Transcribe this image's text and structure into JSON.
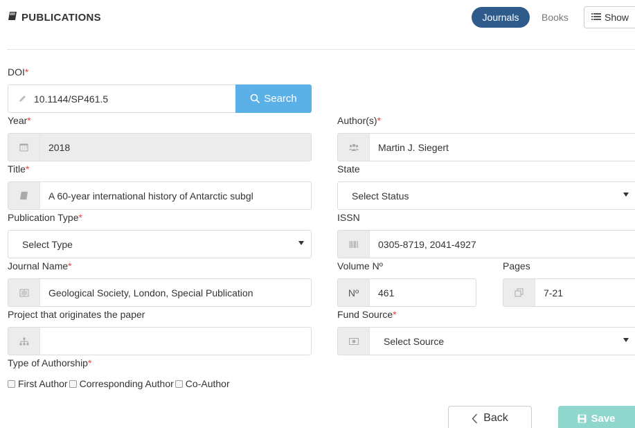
{
  "header": {
    "title": "PUBLICATIONS",
    "tabs": {
      "journals": "Journals",
      "books": "Books",
      "show": "Show"
    }
  },
  "form": {
    "doi": {
      "label": "DOI",
      "value": "10.1144/SP461.5",
      "search_label": "Search"
    },
    "year": {
      "label": "Year",
      "value": "2018"
    },
    "authors": {
      "label": "Author(s)",
      "value": "Martin J. Siegert"
    },
    "title": {
      "label": "Title",
      "value": "A 60-year international history of Antarctic subgl"
    },
    "state": {
      "label": "State",
      "value": "Select Status"
    },
    "publication_type": {
      "label": "Publication Type",
      "value": "Select Type"
    },
    "issn": {
      "label": "ISSN",
      "value": "0305-8719, 2041-4927"
    },
    "journal_name": {
      "label": "Journal Name",
      "value": "Geological Society, London, Special Publication"
    },
    "volume": {
      "label": "Volume Nº",
      "prefix": "Nº",
      "value": "461"
    },
    "pages": {
      "label": "Pages",
      "value": "7-21"
    },
    "project": {
      "label": "Project that originates the paper",
      "value": ""
    },
    "fund_source": {
      "label": "Fund Source",
      "value": "Select Source"
    },
    "authorship": {
      "label": "Type of Authorship",
      "options": [
        "First Author",
        "Corresponding Author",
        "Co-Author"
      ]
    },
    "required_mark": "*"
  },
  "actions": {
    "back": "Back",
    "save": "Save"
  },
  "colors": {
    "primary": "#2e5b8c",
    "search": "#5bb0e8",
    "save": "#8fd6cd",
    "required": "#e5423d"
  },
  "icons": [
    "book-icon",
    "list-icon",
    "pencil-icon",
    "search-icon",
    "calendar-icon",
    "users-icon",
    "barcode-icon",
    "newspaper-icon",
    "copy-icon",
    "sitemap-icon",
    "money-icon",
    "chevron-left-icon",
    "save-icon"
  ]
}
